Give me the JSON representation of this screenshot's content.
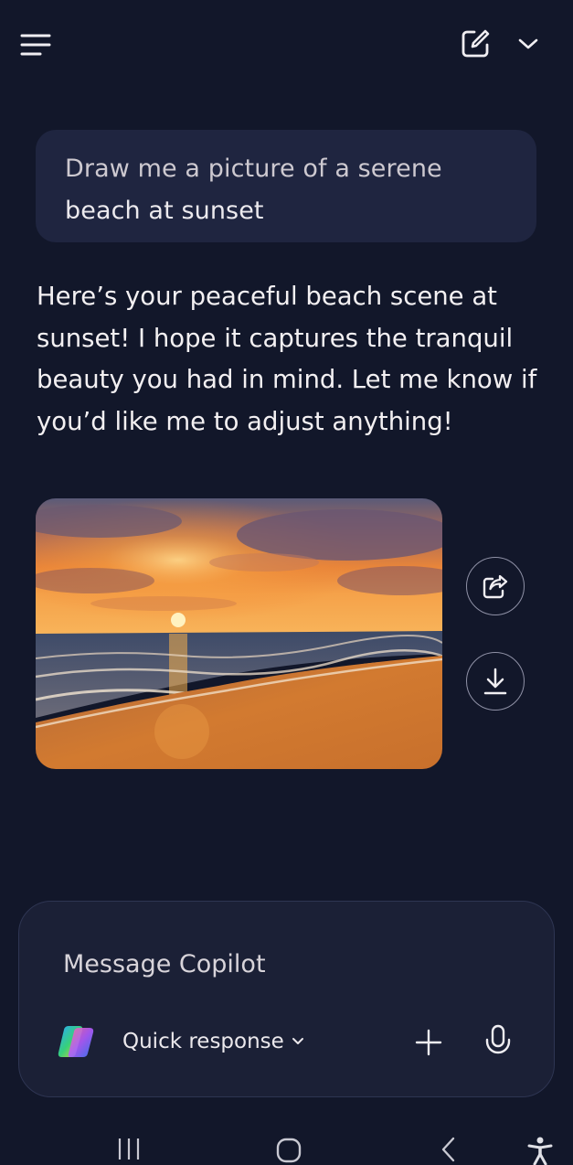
{
  "header": {
    "menu_icon": "hamburger-menu-icon",
    "compose_icon": "new-chat-icon",
    "dropdown_icon": "chevron-down-icon"
  },
  "conversation": {
    "user_message_line1": "Draw me a picture of a serene",
    "user_message_line2": "beach at sunset",
    "assistant_reply": "Here’s your peaceful beach scene at sunset! I hope it captures the tranquil beauty you had in mind. Let me know if you’d like me to adjust anything!",
    "image_description_icon": "generated-image",
    "image_actions": {
      "share_icon": "share-icon",
      "download_icon": "download-icon"
    }
  },
  "composer": {
    "placeholder": "Message Copilot",
    "mode_label": "Quick response",
    "logo_icon": "copilot-logo-icon",
    "add_icon": "plus-icon",
    "voice_icon": "microphone-icon"
  },
  "system_nav": {
    "recents_icon": "recents-icon",
    "home_icon": "home-icon",
    "back_icon": "back-icon",
    "accessibility_icon": "accessibility-icon"
  },
  "colors": {
    "background": "#12172a",
    "bubble": "#1f2540",
    "composer": "#1b2036"
  }
}
